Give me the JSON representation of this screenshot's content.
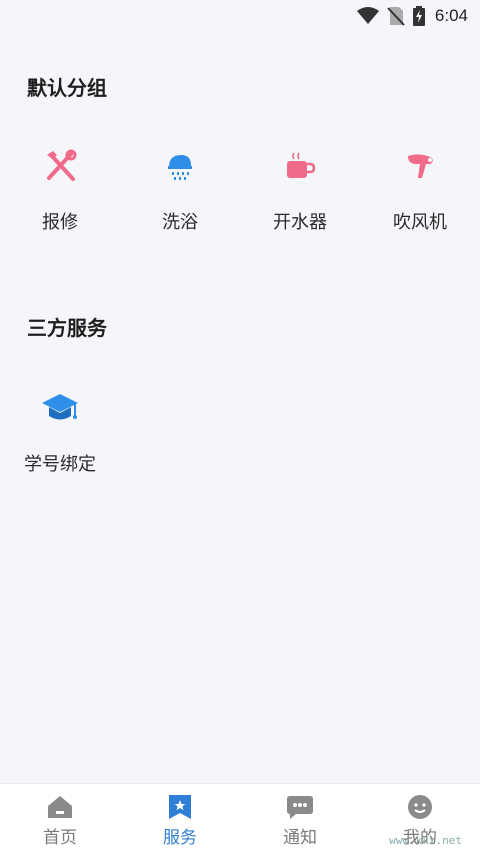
{
  "status_bar": {
    "time": "6:04",
    "icons": [
      "wifi-icon",
      "no-sim-icon",
      "battery-charging-icon"
    ]
  },
  "sections": [
    {
      "title": "默认分组",
      "items": [
        {
          "label": "报修",
          "icon": "repair-tools-icon",
          "color": "#f06b8a"
        },
        {
          "label": "洗浴",
          "icon": "shower-icon",
          "color": "#2e8ee8"
        },
        {
          "label": "开水器",
          "icon": "hot-water-cup-icon",
          "color": "#f06b8a"
        },
        {
          "label": "吹风机",
          "icon": "hair-dryer-icon",
          "color": "#f06b8a"
        }
      ]
    },
    {
      "title": "三方服务",
      "items": [
        {
          "label": "学号绑定",
          "icon": "graduation-cap-icon",
          "color": "#2e8ee8"
        }
      ]
    }
  ],
  "tab_bar": {
    "active": "服务",
    "accent": "#2f7fd6",
    "inactive": "#7a7a7a",
    "tabs": [
      {
        "label": "首页",
        "icon": "home-icon"
      },
      {
        "label": "服务",
        "icon": "service-bookmark-icon"
      },
      {
        "label": "通知",
        "icon": "chat-bubble-icon"
      },
      {
        "label": "我的",
        "icon": "profile-face-icon"
      }
    ]
  },
  "watermark": "www.kkx.net"
}
